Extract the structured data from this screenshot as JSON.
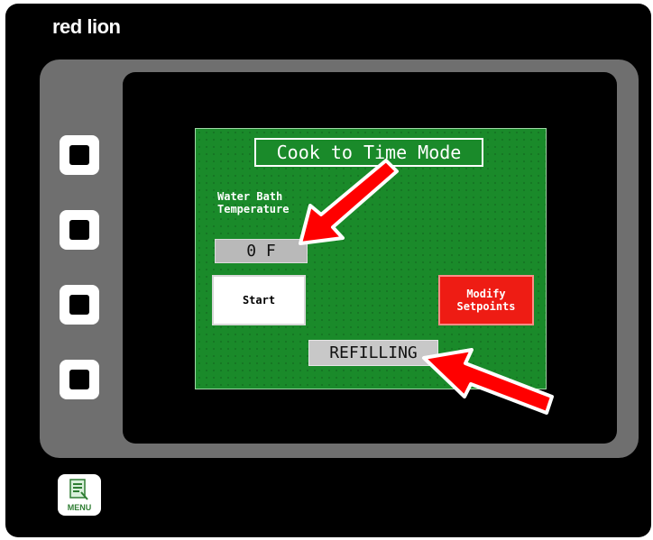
{
  "device": {
    "brand": "red lion",
    "menu_label": "MENU"
  },
  "hmi": {
    "title": "Cook to Time Mode",
    "temperature_label_line1": "Water Bath",
    "temperature_label_line2": "Temperature",
    "temperature_value": "0 F",
    "start_label": "Start",
    "modify_label_line1": "Modify",
    "modify_label_line2": "Setpoints",
    "status": "REFILLING"
  },
  "colors": {
    "screen_green": "#1a8a2a",
    "modify_red": "#ee1c14",
    "arrow_red": "#ff0000"
  },
  "icons": [
    "square-key-icon",
    "menu-icon",
    "arrow-annotation-icon"
  ]
}
